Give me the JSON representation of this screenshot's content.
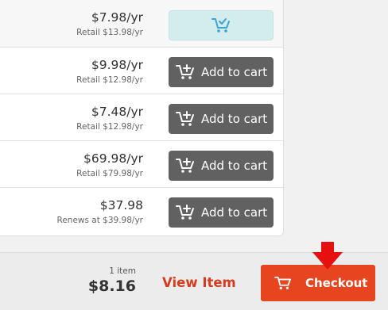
{
  "items": [
    {
      "price": "$7.98/yr",
      "sub": "Retail $13.98/yr",
      "state": "added"
    },
    {
      "price": "$9.98/yr",
      "sub": "Retail $12.98/yr",
      "button_label": "Add to cart"
    },
    {
      "price": "$7.48/yr",
      "sub": "Retail $12.98/yr",
      "button_label": "Add to cart"
    },
    {
      "price": "$69.98/yr",
      "sub": "Retail $79.98/yr",
      "button_label": "Add to cart"
    },
    {
      "price": "$37.98",
      "sub": "Renews at $39.98/yr",
      "button_label": "Add to cart"
    }
  ],
  "footer": {
    "item_count": "1 item",
    "total": "$8.16",
    "view_item_label": "View Item",
    "checkout_label": "Checkout"
  },
  "colors": {
    "accent": "#e6451f",
    "link": "#d73b1f",
    "button": "#616161",
    "added_button": "#d3ecec",
    "added_icon": "#3aa3d6",
    "arrow": "#e6110e"
  },
  "icons": {
    "cart_add": "cart-plus-icon",
    "cart_added": "cart-check-icon",
    "checkout": "cart-icon",
    "pointer": "arrow-down-icon"
  }
}
